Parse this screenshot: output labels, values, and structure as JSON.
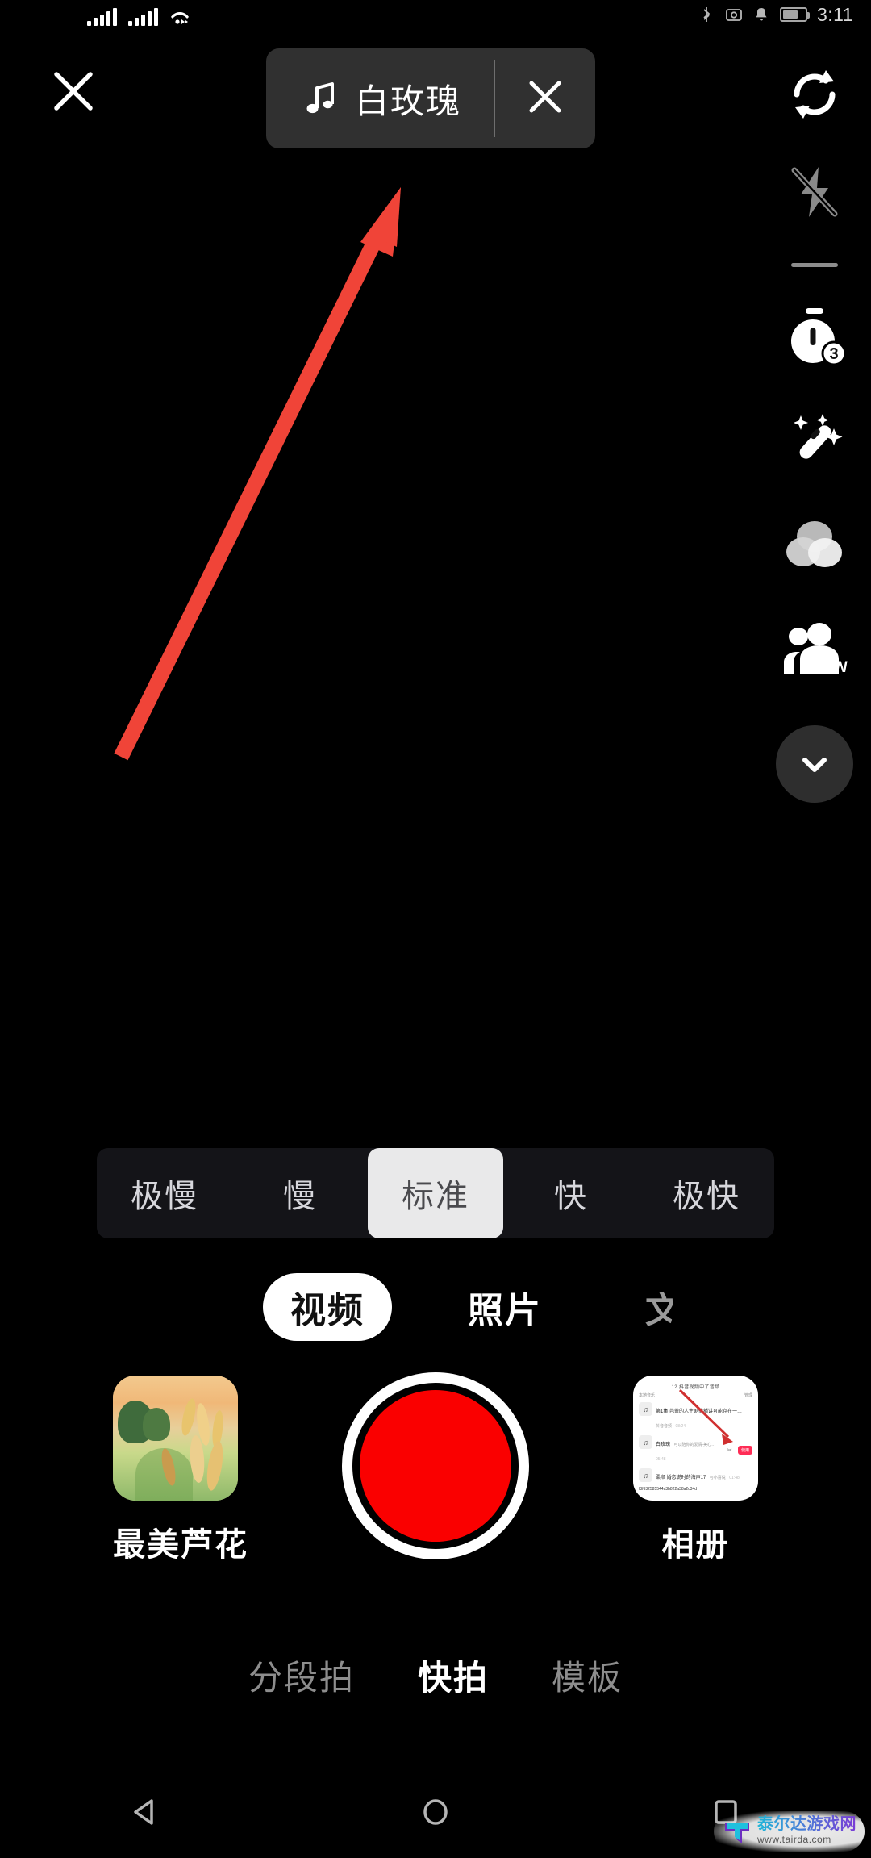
{
  "app": {
    "name": "Douyin Camera",
    "accent_red": "#FA0000",
    "annotation_arrow_color": "#F04438"
  },
  "statusbar": {
    "signal_1_icon": "cellular-signal-icon",
    "signal_2_icon": "cellular-signal-icon",
    "wifi_icon": "wifi-icon",
    "bluetooth_icon": "bluetooth-icon",
    "screenshot_icon": "screenshot-icon",
    "bell_icon": "bell-icon",
    "battery_icon": "battery-icon",
    "time": "3:11"
  },
  "topbar": {
    "close_icon": "close-icon",
    "music": {
      "note_icon": "music-note-icon",
      "title": "白玫瑰",
      "remove_icon": "close-icon"
    }
  },
  "tool_rail": [
    {
      "name": "flip-camera",
      "icon": "camera-flip-icon",
      "label": ""
    },
    {
      "name": "flash",
      "icon": "flash-off-icon",
      "label": ""
    },
    {
      "name": "divider",
      "icon": "divider",
      "label": ""
    },
    {
      "name": "timer",
      "icon": "timer-icon",
      "label": "3"
    },
    {
      "name": "beautify",
      "icon": "magic-wand-icon",
      "label": ""
    },
    {
      "name": "filters",
      "icon": "filter-circles-icon",
      "label": ""
    },
    {
      "name": "co-create",
      "icon": "people-on-icon",
      "label": "ON"
    },
    {
      "name": "more",
      "icon": "chevron-down-icon",
      "label": ""
    }
  ],
  "speed": {
    "options": [
      "极慢",
      "慢",
      "标准",
      "快",
      "极快"
    ],
    "selected_index": 2
  },
  "modes": {
    "tabs": [
      {
        "label": "视频",
        "selected": true
      },
      {
        "label": "照片",
        "selected": false
      },
      {
        "label": "文",
        "selected": false
      }
    ]
  },
  "capture": {
    "effect": {
      "label": "最美芦花",
      "thumb_icon": "reed-landscape-thumbnail"
    },
    "record_button_icon": "record-button",
    "album": {
      "label": "相册",
      "thumb_icon": "screenshot-thumbnail",
      "preview": {
        "header": "12 抖音视频中了音频",
        "left_tag": "本地音乐",
        "right_tag": "管理",
        "rows": [
          {
            "title": "第1集 芭蕾的人生剧情播讲可能存在一…",
            "meta": "抖音音频",
            "time": "08:24",
            "action": ""
          },
          {
            "title": "白玫瑰",
            "meta": "可以陪你的爱情-美心…",
            "time": "05:48",
            "action": "使用"
          },
          {
            "title": "柔顺 婚恋说时的海声17",
            "meta": "与小喜说",
            "time": "01:48",
            "action": ""
          }
        ],
        "footer": "f3f632585544a3b822a38a2c34d"
      }
    }
  },
  "bottom_nav": {
    "items": [
      {
        "label": "分段拍",
        "selected": false
      },
      {
        "label": "快拍",
        "selected": true
      },
      {
        "label": "模板",
        "selected": false
      }
    ]
  },
  "android_nav": {
    "back_icon": "back-triangle-icon",
    "home_icon": "home-circle-icon",
    "recents_icon": "recents-square-icon"
  },
  "watermark": {
    "logo_icon": "tairda-logo-icon",
    "name": "泰尔达游戏网",
    "url": "www.tairda.com"
  }
}
